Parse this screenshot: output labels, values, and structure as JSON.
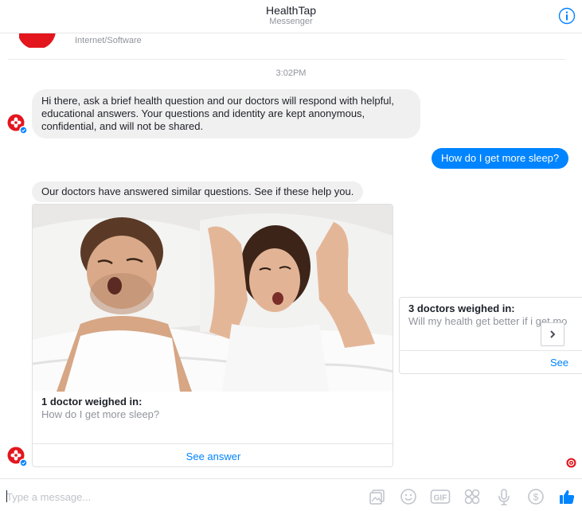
{
  "header": {
    "title": "HealthTap",
    "subtitle": "Messenger"
  },
  "profile": {
    "category": "Internet/Software"
  },
  "conversation": {
    "timestamp": "3:02PM",
    "messages": {
      "greeting": "Hi there, ask a brief health question and our doctors will respond with helpful, educational answers. Your questions and identity are kept anonymous, confidential, and will not be shared.",
      "user_question": "How do I get more sleep?",
      "intro": "Our doctors have answered similar questions. See if these help you."
    },
    "cards": [
      {
        "title": "1 doctor weighed in:",
        "subtitle": "How do I get more sleep?",
        "action": "See answer"
      },
      {
        "title": "3 doctors weighed in:",
        "subtitle": "Will my health get better if i get mo",
        "action": "See"
      }
    ]
  },
  "composer": {
    "placeholder": "Type a message...",
    "tools": [
      "photo-icon",
      "emoji-icon",
      "gif-icon",
      "stickers-icon",
      "microphone-icon",
      "payment-icon",
      "like-icon"
    ]
  },
  "colors": {
    "brand": "#e3161e",
    "accent": "#0084ff",
    "bubble_in": "#f1f0f0"
  }
}
